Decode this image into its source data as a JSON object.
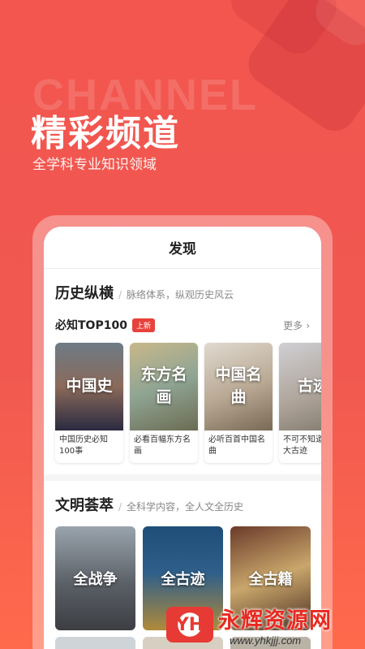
{
  "hero": {
    "bg_text": "CHANNEL",
    "title": "精彩频道",
    "subtitle": "全学科专业知识领域"
  },
  "phone": {
    "header_title": "发现",
    "history": {
      "title": "历史纵横",
      "separator": "/",
      "subtitle": "脉络体系，纵观历史风云",
      "sub_title": "必知TOP100",
      "badge": "上新",
      "more": "更多",
      "cards": [
        {
          "overlay": "中国史",
          "caption": "中国历史必知100事"
        },
        {
          "overlay": "东方名画",
          "caption": "必看百幅东方名画"
        },
        {
          "overlay": "中国名曲",
          "caption": "必听百首中国名曲"
        },
        {
          "overlay": "古迹",
          "caption": "不可不知道的百大古迹"
        }
      ]
    },
    "civilization": {
      "title": "文明荟萃",
      "separator": "/",
      "subtitle": "全科学内容，全人文全历史",
      "cards": [
        {
          "overlay": "全战争"
        },
        {
          "overlay": "全古迹"
        },
        {
          "overlay": "全古籍"
        }
      ]
    }
  },
  "watermark": {
    "logo_text": "YH",
    "name": "永辉资源网",
    "url": "www.yhkjjj.com"
  },
  "colors": {
    "background": "#f2564f",
    "accent": "#e8423c"
  }
}
